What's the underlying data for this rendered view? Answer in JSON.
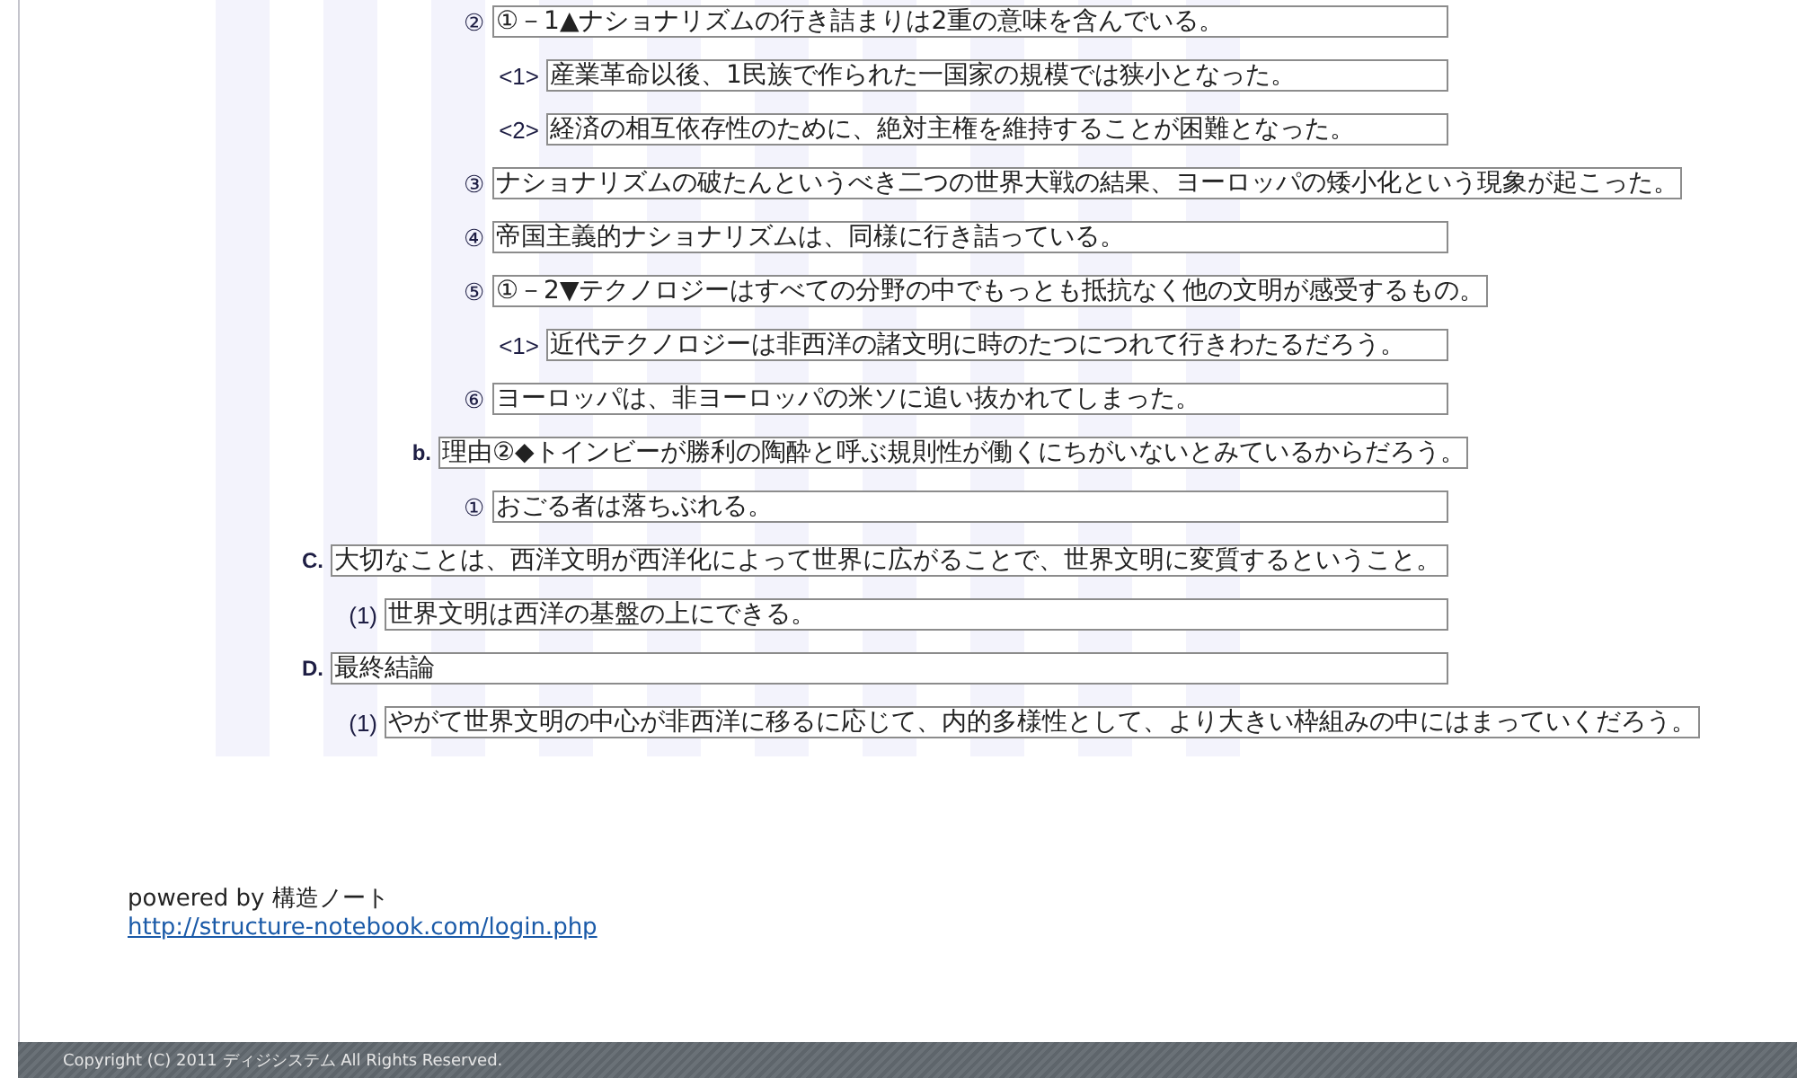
{
  "outline": [
    {
      "children": [
        {
          "children": [
            {
              "children": [
                {
                  "marker": "②",
                  "text": "①－1▲ナショナリズムの行き詰まりは2重の意味を含んでいる。",
                  "children": [
                    {
                      "marker": "<1>",
                      "text": "産業革命以後、1民族で作られた一国家の規模では狭小となった。"
                    },
                    {
                      "marker": "<2>",
                      "text": "経済の相互依存性のために、絶対主権を維持することが困難となった。"
                    }
                  ]
                },
                {
                  "marker": "③",
                  "text": "ナショナリズムの破たんというべき二つの世界大戦の結果、ヨーロッパの矮小化という現象が起こった。"
                },
                {
                  "marker": "④",
                  "text": "帝国主義的ナショナリズムは、同様に行き詰っている。"
                },
                {
                  "marker": "⑤",
                  "text": "①－2▼テクノロジーはすべての分野の中でもっとも抵抗なく他の文明が感受するもの。",
                  "children": [
                    {
                      "marker": "<1>",
                      "text": "近代テクノロジーは非西洋の諸文明に時のたつにつれて行きわたるだろう。"
                    }
                  ]
                },
                {
                  "marker": "⑥",
                  "text": "ヨーロッパは、非ヨーロッパの米ソに追い抜かれてしまった。"
                }
              ]
            },
            {
              "marker": "b.",
              "text": "理由②◆トインビーが勝利の陶酔と呼ぶ規則性が働くにちがいないとみているからだろう。",
              "children": [
                {
                  "marker": "①",
                  "text": "おごる者は落ちぶれる。"
                }
              ]
            }
          ]
        }
      ]
    },
    {
      "marker": "C.",
      "text": "大切なことは、西洋文明が西洋化によって世界に広がることで、世界文明に変質するということ。",
      "children": [
        {
          "marker": "(1)",
          "text": "世界文明は西洋の基盤の上にできる。"
        }
      ]
    },
    {
      "marker": "D.",
      "text": "最終結論",
      "children": [
        {
          "marker": "(1)",
          "text": "やがて世界文明の中心が非西洋に移るに応じて、内的多様性として、より大きい枠組みの中にはまっていくだろう。"
        }
      ]
    }
  ],
  "footer": {
    "powered_by": "powered by 構造ノート",
    "link": "http://structure-notebook.com/login.php"
  },
  "copyright": "Copyright (C) 2011 ディジシステム All Rights Reserved."
}
